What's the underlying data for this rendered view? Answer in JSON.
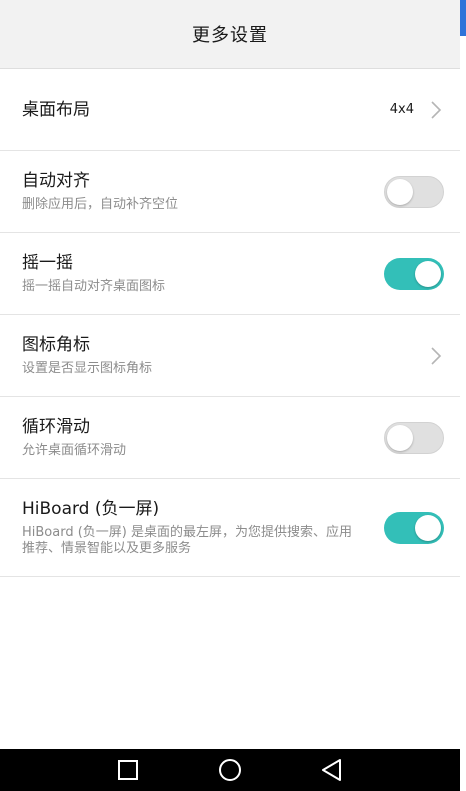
{
  "header": {
    "title": "更多设置"
  },
  "rows": [
    {
      "title": "桌面布局",
      "value": "4x4",
      "type": "chevron"
    },
    {
      "title": "自动对齐",
      "subtitle": "删除应用后，自动补齐空位",
      "type": "toggle",
      "enabled": false
    },
    {
      "title": "摇一摇",
      "subtitle": "摇一摇自动对齐桌面图标",
      "type": "toggle",
      "enabled": true
    },
    {
      "title": "图标角标",
      "subtitle": "设置是否显示图标角标",
      "type": "chevron"
    },
    {
      "title": "循环滑动",
      "subtitle": "允许桌面循环滑动",
      "type": "toggle",
      "enabled": false
    },
    {
      "title": "HiBoard (负一屏)",
      "subtitle": "HiBoard (负一屏) 是桌面的最左屏，为您提供搜索、应用推荐、情景智能以及更多服务",
      "type": "toggle",
      "enabled": true
    }
  ],
  "colors": {
    "toggle_on": "#33bfb8",
    "toggle_off": "#e0e0e0",
    "header_bg": "#f2f2f2"
  },
  "navbar": {
    "icons": [
      "recent-apps-icon",
      "home-icon",
      "back-icon"
    ]
  }
}
